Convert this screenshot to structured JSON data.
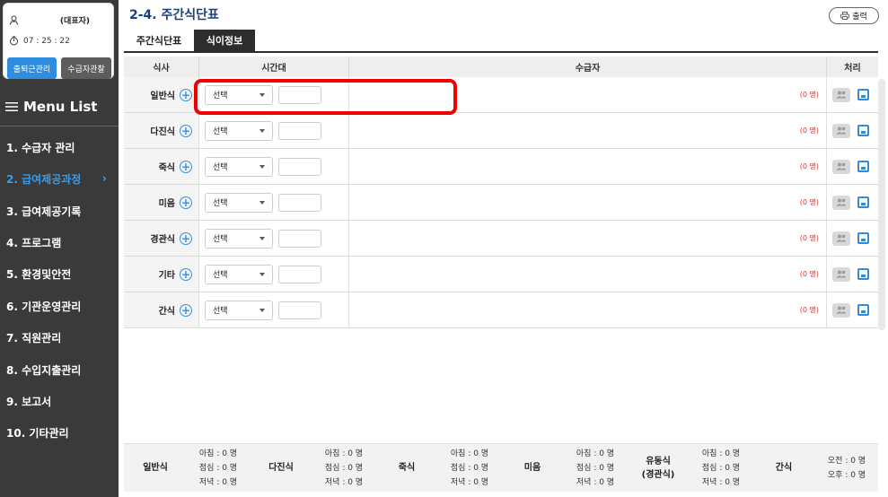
{
  "user": {
    "role": "(대표자)",
    "time": "07 : 25 : 22"
  },
  "buttons": {
    "attendance": "출퇴근관리",
    "observe": "수급자관찰"
  },
  "menu": {
    "title": "Menu List",
    "items": [
      {
        "label": "1. 수급자 관리"
      },
      {
        "label": "2. 급여제공과정"
      },
      {
        "label": "3. 급여제공기록"
      },
      {
        "label": "4. 프로그램"
      },
      {
        "label": "5. 환경및안전"
      },
      {
        "label": "6. 기관운영관리"
      },
      {
        "label": "7. 직원관리"
      },
      {
        "label": "8. 수입지출관리"
      },
      {
        "label": "9. 보고서"
      },
      {
        "label": "10. 기타관리"
      }
    ],
    "chevron": "›"
  },
  "page": {
    "title": "2-4. 주간식단표",
    "print": "출력"
  },
  "tabs": [
    {
      "label": "주간식단표"
    },
    {
      "label": "식이정보"
    }
  ],
  "grid": {
    "headers": {
      "meal": "식사",
      "time": "시간대",
      "recipients": "수급자",
      "action": "처리"
    },
    "select_default": "선택",
    "rows": [
      {
        "meal": "일반식",
        "count": "(0 명)"
      },
      {
        "meal": "다진식",
        "count": "(0 명)"
      },
      {
        "meal": "죽식",
        "count": "(0 명)"
      },
      {
        "meal": "미음",
        "count": "(0 명)"
      },
      {
        "meal": "경관식",
        "count": "(0 명)"
      },
      {
        "meal": "기타",
        "count": "(0 명)"
      },
      {
        "meal": "간식",
        "count": "(0 명)"
      }
    ]
  },
  "summary": [
    {
      "label": "일반식",
      "l1": "아침 : 0 명",
      "l2": "점심 : 0 명",
      "l3": "저녁 : 0 명"
    },
    {
      "label": "다진식",
      "l1": "아침 : 0 명",
      "l2": "점심 : 0 명",
      "l3": "저녁 : 0 명"
    },
    {
      "label": "죽식",
      "l1": "아침 : 0 명",
      "l2": "점심 : 0 명",
      "l3": "저녁 : 0 명"
    },
    {
      "label": "미음",
      "l1": "아침 : 0 명",
      "l2": "점심 : 0 명",
      "l3": "저녁 : 0 명"
    },
    {
      "label": "유동식",
      "label2": "(경관식)",
      "l1": "아침 : 0 명",
      "l2": "점심 : 0 명",
      "l3": "저녁 : 0 명"
    },
    {
      "label": "간식",
      "l1": "오전 : 0 명",
      "l2": "오후 : 0 명",
      "l3": ""
    }
  ],
  "colors": {
    "sidebar": "#3a3a3a",
    "accent": "#2f8ddf",
    "title": "#1c3f7a",
    "highlight": "#f00000"
  }
}
